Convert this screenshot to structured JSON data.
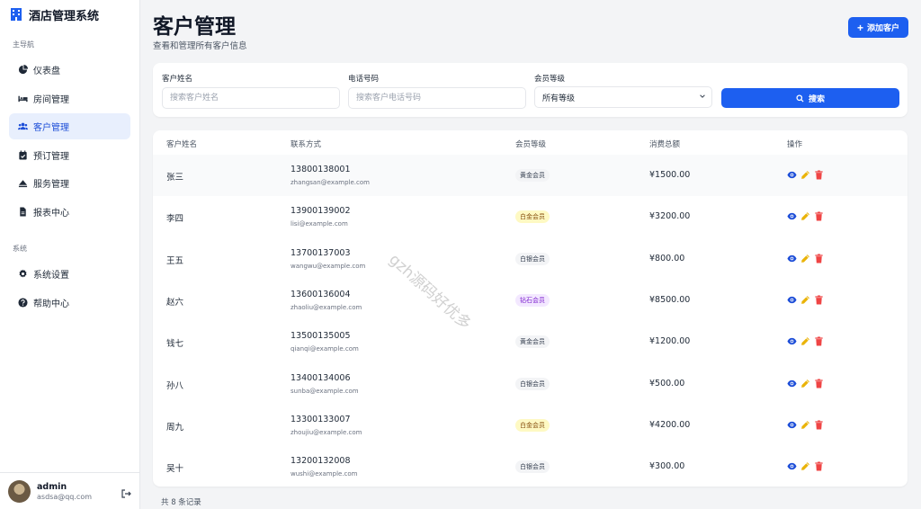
{
  "app": {
    "title": "酒店管理系统"
  },
  "sidebar": {
    "section_main": "主导航",
    "section_system": "系统",
    "main_items": [
      {
        "label": "仪表盘",
        "icon": "dashboard-icon"
      },
      {
        "label": "房间管理",
        "icon": "bed-icon"
      },
      {
        "label": "客户管理",
        "icon": "users-icon",
        "active": true
      },
      {
        "label": "预订管理",
        "icon": "calendar-check-icon"
      },
      {
        "label": "服务管理",
        "icon": "bell-icon"
      },
      {
        "label": "报表中心",
        "icon": "file-icon"
      }
    ],
    "system_items": [
      {
        "label": "系统设置",
        "icon": "gear-icon"
      },
      {
        "label": "帮助中心",
        "icon": "help-icon"
      }
    ],
    "user": {
      "name": "admin",
      "email": "asdsa@qq.com"
    }
  },
  "header": {
    "title": "客户管理",
    "subtitle": "查看和管理所有客户信息",
    "add_button": "添加客户"
  },
  "filters": {
    "name_label": "客户姓名",
    "name_placeholder": "搜索客户姓名",
    "phone_label": "电话号码",
    "phone_placeholder": "搜索客户电话号码",
    "level_label": "会员等级",
    "level_value": "所有等级",
    "search_button": "搜索"
  },
  "table": {
    "headers": [
      "客户姓名",
      "联系方式",
      "会员等级",
      "消费总额",
      "操作"
    ],
    "rows": [
      {
        "name": "张三",
        "phone": "13800138001",
        "email": "zhangsan@example.com",
        "level": "黄金会员",
        "level_type": "gold",
        "total": "¥1500.00"
      },
      {
        "name": "李四",
        "phone": "13900139002",
        "email": "lisi@example.com",
        "level": "白金会员",
        "level_type": "platinum",
        "total": "¥3200.00"
      },
      {
        "name": "王五",
        "phone": "13700137003",
        "email": "wangwu@example.com",
        "level": "白银会员",
        "level_type": "silver",
        "total": "¥800.00"
      },
      {
        "name": "赵六",
        "phone": "13600136004",
        "email": "zhaoliu@example.com",
        "level": "钻石会员",
        "level_type": "diamond",
        "total": "¥8500.00"
      },
      {
        "name": "钱七",
        "phone": "13500135005",
        "email": "qianqi@example.com",
        "level": "黄金会员",
        "level_type": "gold",
        "total": "¥1200.00"
      },
      {
        "name": "孙八",
        "phone": "13400134006",
        "email": "sunba@example.com",
        "level": "白银会员",
        "level_type": "silver",
        "total": "¥500.00"
      },
      {
        "name": "周九",
        "phone": "13300133007",
        "email": "zhoujiu@example.com",
        "level": "白金会员",
        "level_type": "platinum",
        "total": "¥4200.00"
      },
      {
        "name": "吴十",
        "phone": "13200132008",
        "email": "wushi@example.com",
        "level": "白银会员",
        "level_type": "silver",
        "total": "¥300.00"
      }
    ],
    "footer": "共 8 条记录"
  },
  "watermark": "gzh源码好优多",
  "colors": {
    "primary": "#1d5ff0",
    "view": "#1d4ed8",
    "edit": "#eab308",
    "delete": "#ef4444"
  }
}
